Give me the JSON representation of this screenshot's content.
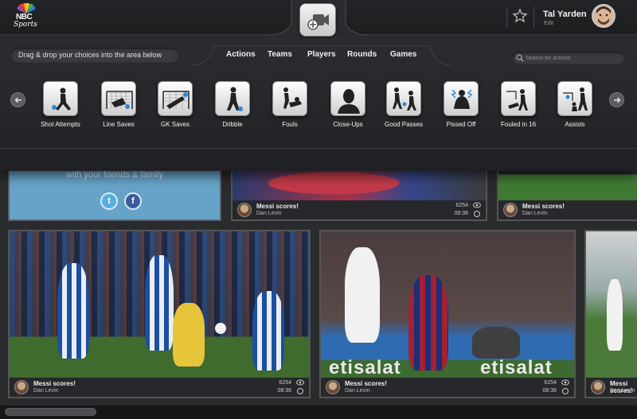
{
  "header": {
    "logo": {
      "nbc": "NBC",
      "sports": "Sports"
    },
    "user": {
      "name": "Tal Yarden",
      "edit": "Edit"
    }
  },
  "toolbar": {
    "hint": "Drag & drop your choices into the area below",
    "nav": [
      "Actions",
      "Teams",
      "Players",
      "Rounds",
      "Games"
    ],
    "search_placeholder": "Search for actions"
  },
  "actions": [
    {
      "label": "Shot Attempts",
      "icon": "shot-attempt-icon"
    },
    {
      "label": "Line Saves",
      "icon": "line-save-icon"
    },
    {
      "label": "GK Saves",
      "icon": "gk-save-icon"
    },
    {
      "label": "Dribble",
      "icon": "dribble-icon"
    },
    {
      "label": "Fouls",
      "icon": "foul-icon"
    },
    {
      "label": "Close-Ups",
      "icon": "close-up-icon"
    },
    {
      "label": "Good Passes",
      "icon": "good-pass-icon"
    },
    {
      "label": "Pissed Off",
      "icon": "pissed-off-icon"
    },
    {
      "label": "Fouled in 16",
      "icon": "fouled-in-16-icon"
    },
    {
      "label": "Assists",
      "icon": "assist-icon"
    }
  ],
  "share": {
    "text": "with your friends & family"
  },
  "videos": [
    {
      "title": "Messi scores!",
      "author": "Dan Levin",
      "views": "6254",
      "time": "08:36"
    },
    {
      "title": "Messi scores!",
      "author": "Dan Levin",
      "views": "6254",
      "time": "08:36"
    },
    {
      "title": "Messi scores!",
      "author": "Dan Levin",
      "views": "6254",
      "time": "08:36"
    },
    {
      "title": "Messi scores!",
      "author": "Dan Levin",
      "views": "6254",
      "time": "08:36"
    },
    {
      "title": "Messi scores!",
      "author": "Dan Levin"
    }
  ],
  "colors": {
    "share_bg": "#67a3c8",
    "twitter": "#58aee0",
    "facebook": "#3a5c9a",
    "barca_red": "#a32035",
    "espanyol_blue": "#2f6fc0"
  }
}
